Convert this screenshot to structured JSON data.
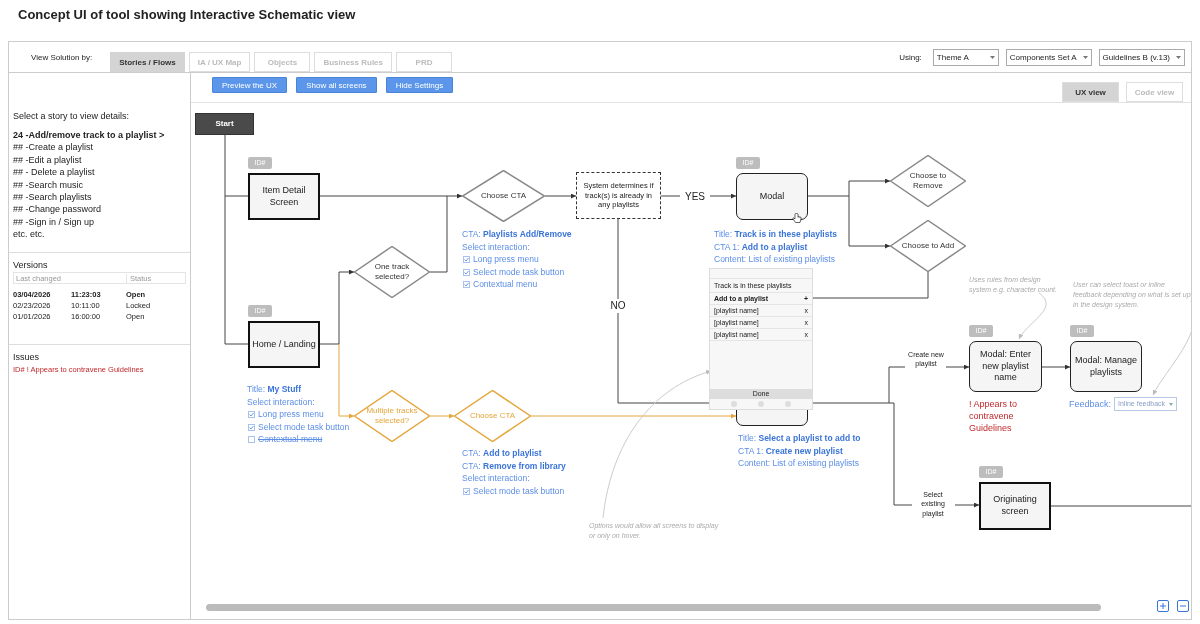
{
  "page_title": "Concept UI of tool showing Interactive Schematic view",
  "topbar": {
    "view_label": "View Solution by:",
    "tabs": [
      {
        "label": "Stories / Flows",
        "selected": true
      },
      {
        "label": "IA / UX Map",
        "selected": false
      },
      {
        "label": "Objects",
        "selected": false
      },
      {
        "label": "Business Rules",
        "selected": false
      },
      {
        "label": "PRD",
        "selected": false
      }
    ],
    "using_label": "Using:",
    "dropdowns": [
      "Theme A",
      "Components Set A",
      "Guidelines B (v.13)"
    ]
  },
  "sidebar": {
    "prompt": "Select a story to view details:",
    "stories": [
      {
        "text": "24  -Add/remove track to a playlist >",
        "selected": true
      },
      {
        "text": "## -Create a playlist",
        "selected": false
      },
      {
        "text": "## -Edit a playlist",
        "selected": false
      },
      {
        "text": "## - Delete a playlist",
        "selected": false
      },
      {
        "text": "## -Search music",
        "selected": false
      },
      {
        "text": "## -Search playlists",
        "selected": false
      },
      {
        "text": "## -Change password",
        "selected": false
      },
      {
        "text": "## -Sign in / Sign up",
        "selected": false
      },
      {
        "text": "etc. etc.",
        "selected": false
      }
    ],
    "versions": {
      "title": "Versions",
      "columns": [
        "Last changed",
        "Status"
      ],
      "rows": [
        {
          "date": "03/04/2026",
          "time": "11:23:03",
          "status": "Open",
          "current": true
        },
        {
          "date": "02/23/2026",
          "time": "10:11:00",
          "status": "Locked",
          "current": false
        },
        {
          "date": "01/01/2026",
          "time": "16:00:00",
          "status": "Open",
          "current": false
        }
      ]
    },
    "issues": {
      "title": "Issues",
      "items": [
        "ID# ! Appears to contravene Guidelines"
      ]
    }
  },
  "main": {
    "buttons": [
      "Preview the UX",
      "Show all screens",
      "Hide Settings"
    ],
    "view_tabs": [
      {
        "label": "UX view",
        "selected": true
      },
      {
        "label": "Code view",
        "selected": false
      }
    ],
    "nodes": [
      {
        "kind": "start",
        "text": "Start"
      },
      {
        "kind": "screen",
        "tag": "ID#",
        "text": "Item Detail Screen"
      },
      {
        "kind": "screen",
        "tag": "ID#",
        "text": "Home / Landing"
      },
      {
        "kind": "decision",
        "text": "One track selected?",
        "color": "#888888"
      },
      {
        "kind": "decision",
        "text": "Choose CTA",
        "color": "#888888"
      },
      {
        "kind": "process",
        "text": "System determines if track(s) is already in any playlists"
      },
      {
        "kind": "modal",
        "tag": "ID#",
        "text": "Modal"
      },
      {
        "kind": "decision",
        "text": "Choose to Remove",
        "color": "#888888"
      },
      {
        "kind": "decision",
        "text": "Choose to Add",
        "color": "#888888"
      },
      {
        "kind": "modal"
      },
      {
        "kind": "device",
        "title": "Track is in these playlists",
        "rows": [
          {
            "text": "Add to a playlist",
            "action": "+",
            "header": true
          },
          {
            "text": "[playlist name]",
            "action": "x",
            "header": false
          },
          {
            "text": "[playlist name]",
            "action": "x",
            "header": false
          },
          {
            "text": "[playlist name]",
            "action": "x",
            "header": false
          }
        ],
        "button": "Done"
      },
      {
        "kind": "decision",
        "text": "Multiple tracks selected?",
        "color": "#e3a63a"
      },
      {
        "kind": "decision",
        "text": "Choose CTA",
        "color": "#e3a63a"
      },
      {
        "kind": "modal",
        "tag": "ID#",
        "text": "Modal: Enter new playlist name"
      },
      {
        "kind": "modal",
        "tag": "ID#",
        "text": "Modal: Manage playlists"
      },
      {
        "kind": "screen",
        "tag": "ID#",
        "text": "Originating screen"
      }
    ],
    "edge_labels": [
      "YES",
      "NO",
      "Create new playlist",
      "Select existing playlist"
    ],
    "annotations": [
      {
        "lines": [
          {
            "kind": "text",
            "text": "CTA: **Playlists Add/Remove**"
          },
          {
            "kind": "text",
            "text": "Select interaction:"
          },
          {
            "kind": "option",
            "text": "Long press menu",
            "checked": true
          },
          {
            "kind": "option",
            "text": "Select mode task button",
            "checked": true
          },
          {
            "kind": "option",
            "text": "Contextual menu",
            "checked": true
          }
        ]
      },
      {
        "lines": [
          {
            "kind": "text",
            "text": "Title: **Track is in these playlists**"
          },
          {
            "kind": "text",
            "text": "CTA 1: **Add to a playlist**"
          },
          {
            "kind": "text",
            "text": "Content: List of existing playlists"
          }
        ]
      },
      {
        "lines": [
          {
            "kind": "text",
            "text": "Title: **My Stuff**"
          },
          {
            "kind": "text",
            "text": "Select interaction:"
          },
          {
            "kind": "option",
            "text": "Long press menu",
            "checked": true
          },
          {
            "kind": "option",
            "text": "Select mode task button",
            "checked": true
          },
          {
            "kind": "option",
            "text": "Contextual menu",
            "checked": false
          }
        ]
      },
      {
        "lines": [
          {
            "kind": "text",
            "text": "Title: **Select a playlist to add to**"
          },
          {
            "kind": "text",
            "text": "CTA 1: **Create new playlist**"
          },
          {
            "kind": "text",
            "text": "Content: List of existing playlists"
          }
        ]
      },
      {
        "lines": [
          {
            "kind": "text",
            "text": "CTA: **Add to playlist**"
          },
          {
            "kind": "text",
            "text": "CTA: **Remove from library**"
          },
          {
            "kind": "text",
            "text": "Select interaction:"
          },
          {
            "kind": "option",
            "text": "Select mode task button",
            "checked": true
          }
        ]
      },
      {
        "lines": [
          {
            "kind": "issue",
            "text": "! Appears to contravene Guidelines"
          }
        ]
      },
      {
        "lines": [
          {
            "kind": "feedback",
            "text": "Feedback:",
            "value": "Inline feedback"
          }
        ]
      }
    ],
    "notes": [
      "Uses rules from design system e.g. character count.",
      "User can select toast or inline feedback depending on what is set up in the design system.",
      "Options would allow all screens to display or only on hover."
    ]
  }
}
